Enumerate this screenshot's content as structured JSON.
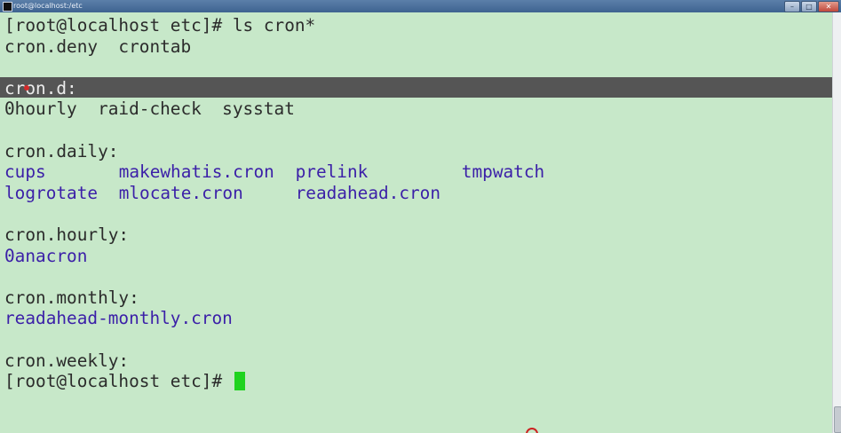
{
  "window": {
    "title": "root@localhost:/etc",
    "controls": {
      "minimize": "–",
      "maximize": "□",
      "close": "✕"
    }
  },
  "terminal": {
    "lines": [
      {
        "id": "prompt1",
        "segments": [
          {
            "text": "[root@localhost etc]# ls cron*",
            "kind": "text"
          }
        ]
      },
      {
        "id": "files1",
        "segments": [
          {
            "text": "cron.deny  crontab",
            "kind": "text"
          }
        ]
      },
      {
        "id": "blank1",
        "segments": []
      },
      {
        "id": "crond-header",
        "segments": [
          {
            "text": "cron.d:",
            "kind": "text"
          }
        ],
        "selected": true
      },
      {
        "id": "crond-list",
        "segments": [
          {
            "text": "0hourly  raid-check  sysstat",
            "kind": "text"
          }
        ]
      },
      {
        "id": "blank2",
        "segments": []
      },
      {
        "id": "daily-header",
        "segments": [
          {
            "text": "cron.daily:",
            "kind": "text"
          }
        ]
      },
      {
        "id": "daily-list1",
        "segments": [
          {
            "text": "cups",
            "kind": "file"
          },
          {
            "text": "makewhatis.cron",
            "kind": "file"
          },
          {
            "text": "prelink",
            "kind": "file"
          },
          {
            "text": "tmpwatch",
            "kind": "file"
          }
        ]
      },
      {
        "id": "daily-list2",
        "segments": [
          {
            "text": "logrotate",
            "kind": "file"
          },
          {
            "text": "mlocate.cron",
            "kind": "file"
          },
          {
            "text": "readahead.cron",
            "kind": "file"
          }
        ]
      },
      {
        "id": "blank3",
        "segments": []
      },
      {
        "id": "hourly-header",
        "segments": [
          {
            "text": "cron.hourly:",
            "kind": "text"
          }
        ]
      },
      {
        "id": "hourly-list",
        "segments": [
          {
            "text": "0anacron",
            "kind": "file"
          }
        ]
      },
      {
        "id": "blank4",
        "segments": []
      },
      {
        "id": "monthly-header",
        "segments": [
          {
            "text": "cron.monthly:",
            "kind": "text"
          }
        ]
      },
      {
        "id": "monthly-list",
        "segments": [
          {
            "text": "readahead-monthly.cron",
            "kind": "file"
          }
        ]
      },
      {
        "id": "blank5",
        "segments": []
      },
      {
        "id": "weekly-header",
        "segments": [
          {
            "text": "cron.weekly:",
            "kind": "text"
          }
        ]
      },
      {
        "id": "prompt2",
        "segments": [
          {
            "text": "[root@localhost etc]# ",
            "kind": "text"
          }
        ]
      }
    ]
  },
  "colors": {
    "background": "#c7e8c9",
    "text": "#2b2b2b",
    "executable": "#3b1fa8",
    "selection": "#555555",
    "cursor": "#1fd31f"
  }
}
